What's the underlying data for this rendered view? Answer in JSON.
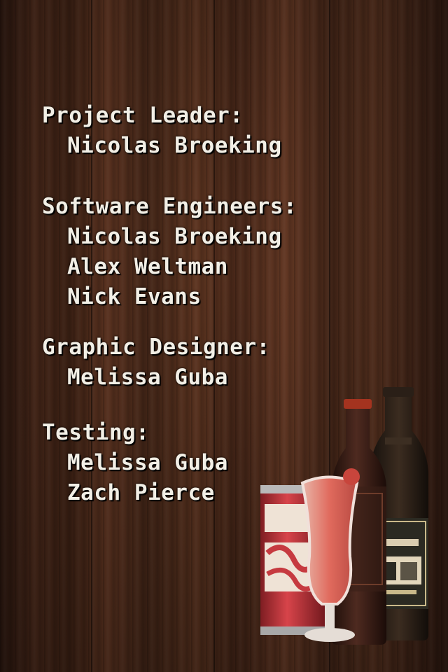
{
  "credits": [
    {
      "role": "Project Leader:",
      "names": [
        "Nicolas Broeking"
      ]
    },
    {
      "role": "Software Engineers:",
      "names": [
        "Nicolas Broeking",
        "Alex Weltman",
        "Nick Evans"
      ]
    },
    {
      "role": "Graphic Designer:",
      "names": [
        "Melissa Guba"
      ]
    },
    {
      "role": "Testing:",
      "names": [
        "Melissa Guba",
        "Zach Pierce"
      ]
    }
  ],
  "illustration": {
    "name": "drinks-illustration",
    "items": [
      "soda-can-icon",
      "hurricane-glass-icon",
      "beer-bottle-icon",
      "ale-bottle-icon"
    ]
  }
}
